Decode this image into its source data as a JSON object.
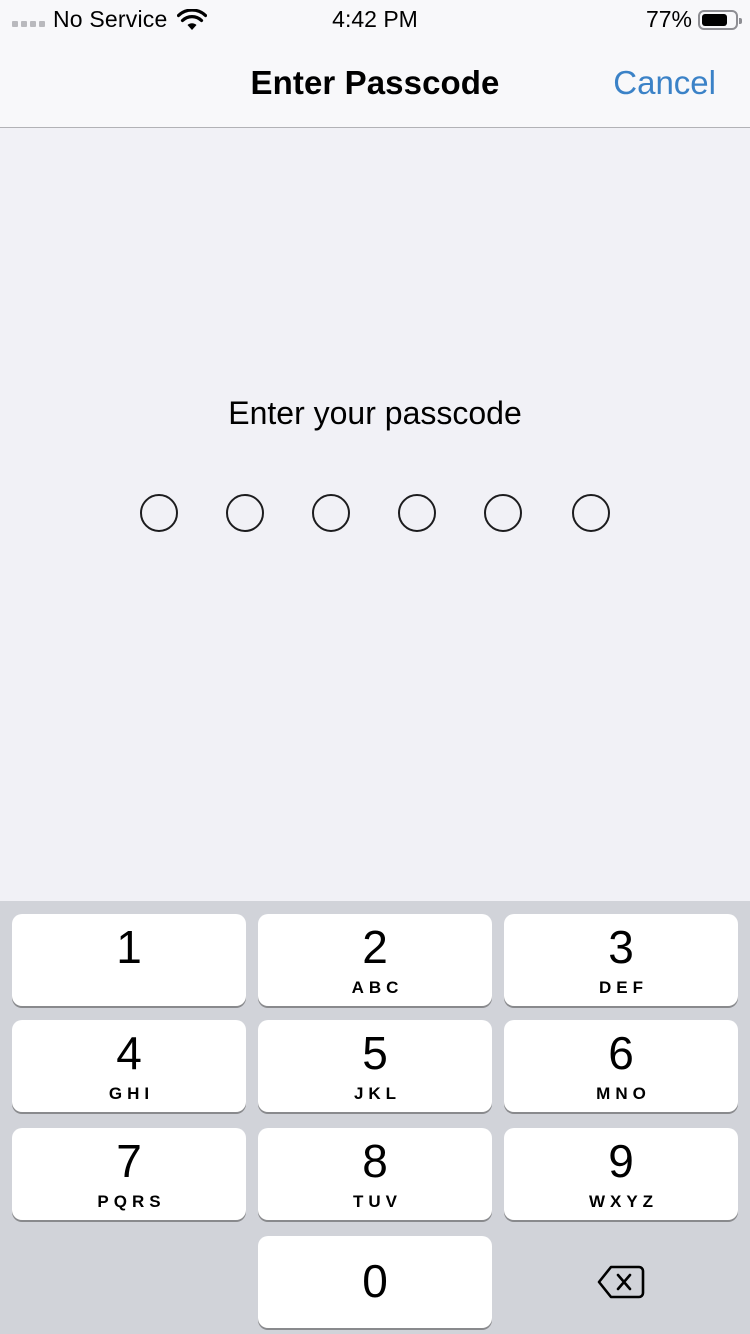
{
  "status_bar": {
    "carrier": "No Service",
    "time": "4:42 PM",
    "battery_percent_label": "77%",
    "battery_level": 0.77,
    "icons": [
      "signal-dots-icon",
      "wifi-icon",
      "battery-icon"
    ]
  },
  "nav": {
    "title": "Enter Passcode",
    "cancel_label": "Cancel",
    "accent_color": "#3b82c7"
  },
  "prompt": {
    "text": "Enter your passcode",
    "digits_total": 6,
    "digits_entered": 0
  },
  "keypad": {
    "keys": [
      {
        "digit": "1",
        "letters": ""
      },
      {
        "digit": "2",
        "letters": "ABC"
      },
      {
        "digit": "3",
        "letters": "DEF"
      },
      {
        "digit": "4",
        "letters": "GHI"
      },
      {
        "digit": "5",
        "letters": "JKL"
      },
      {
        "digit": "6",
        "letters": "MNO"
      },
      {
        "digit": "7",
        "letters": "PQRS"
      },
      {
        "digit": "8",
        "letters": "TUV"
      },
      {
        "digit": "9",
        "letters": "WXYZ"
      },
      {
        "digit": "0",
        "letters": ""
      }
    ],
    "delete_icon": "delete-backspace-icon"
  }
}
